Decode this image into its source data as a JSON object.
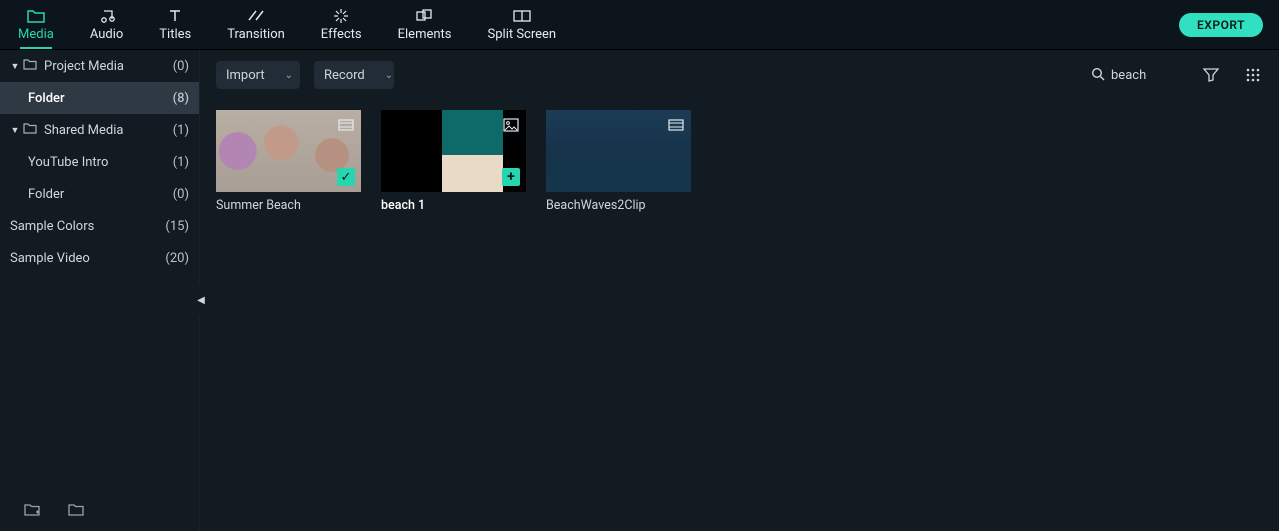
{
  "topTabs": [
    {
      "label": "Media",
      "icon": "folder-icon",
      "active": true
    },
    {
      "label": "Audio",
      "icon": "music-icon"
    },
    {
      "label": "Titles",
      "icon": "text-icon"
    },
    {
      "label": "Transition",
      "icon": "transition-icon"
    },
    {
      "label": "Effects",
      "icon": "sparkle-icon"
    },
    {
      "label": "Elements",
      "icon": "shapes-icon"
    },
    {
      "label": "Split Screen",
      "icon": "splitscreen-icon"
    }
  ],
  "export_label": "EXPORT",
  "sidebar": {
    "items": [
      {
        "label": "Project Media",
        "count": "(0)",
        "expandable": true,
        "hasFolder": true
      },
      {
        "label": "Folder",
        "count": "(8)",
        "child": true,
        "selected": true
      },
      {
        "label": "Shared Media",
        "count": "(1)",
        "expandable": true,
        "hasFolder": true
      },
      {
        "label": "YouTube Intro",
        "count": "(1)",
        "child": true
      },
      {
        "label": "Folder",
        "count": "(0)",
        "child": true
      },
      {
        "label": "Sample Colors",
        "count": "(15)",
        "noarrow": true
      },
      {
        "label": "Sample Video",
        "count": "(20)",
        "noarrow": true
      }
    ]
  },
  "toolbar": {
    "import_label": "Import",
    "record_label": "Record"
  },
  "search": {
    "value": "beach"
  },
  "cards": [
    {
      "title": "Summer Beach",
      "kind": "video",
      "badge": "check"
    },
    {
      "title": "beach 1",
      "kind": "image",
      "badge": "plus",
      "selected": true
    },
    {
      "title": "BeachWaves2Clip",
      "kind": "video"
    }
  ]
}
